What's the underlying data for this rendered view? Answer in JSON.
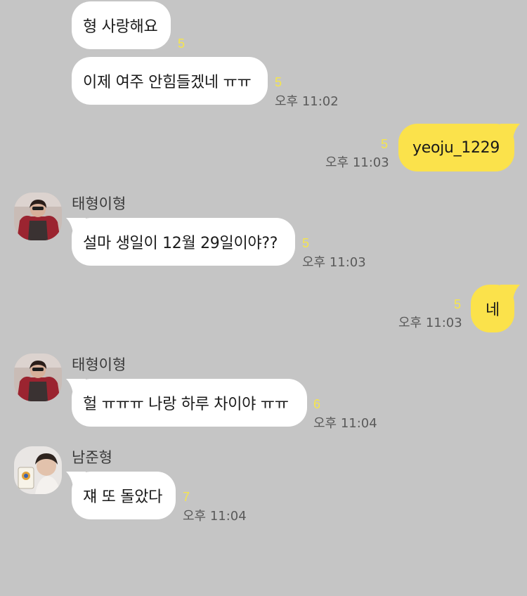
{
  "messages": [
    {
      "text": "형 사랑해요",
      "unread": "5"
    },
    {
      "text": "이제 여주 안힘들겠네 ㅠㅠ",
      "unread": "5",
      "time": "오후 11:02"
    },
    {
      "text": "yeoju_1229",
      "unread": "5",
      "time": "오후 11:03"
    },
    {
      "sender": "태형이형",
      "text": "설마 생일이 12월 29일이야??",
      "unread": "5",
      "time": "오후 11:03"
    },
    {
      "text": "네",
      "unread": "5",
      "time": "오후 11:03"
    },
    {
      "sender": "태형이형",
      "text": "헐 ㅠㅠㅠ 나랑 하루 차이야 ㅠㅠ",
      "unread": "6",
      "time": "오후 11:04"
    },
    {
      "sender": "남준형",
      "text": "쟤 또 돌았다",
      "unread": "7",
      "time": "오후 11:04"
    }
  ],
  "colors": {
    "background": "#c5c5c5",
    "incoming_bubble": "#ffffff",
    "outgoing_bubble": "#fbe24b",
    "unread_count": "#f5e54d"
  }
}
